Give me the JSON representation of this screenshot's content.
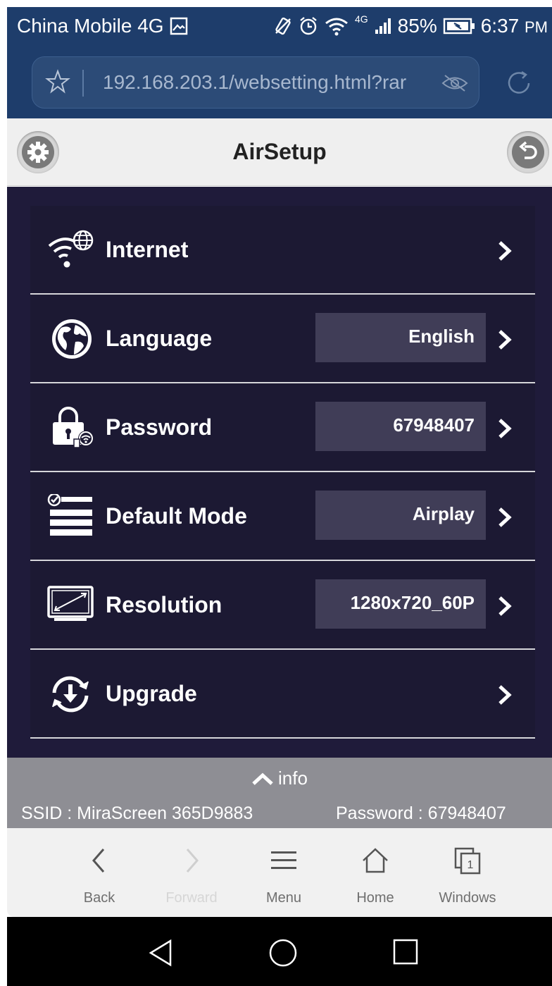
{
  "status_bar": {
    "carrier": "China Mobile 4G",
    "signal_label": "4G",
    "battery": "85%",
    "time": "6:37",
    "ampm": "PM"
  },
  "browser": {
    "url": "192.168.203.1/websetting.html?rar"
  },
  "app": {
    "title": "AirSetup"
  },
  "menu": {
    "internet": {
      "label": "Internet"
    },
    "language": {
      "label": "Language",
      "value": "English"
    },
    "password": {
      "label": "Password",
      "value": "67948407"
    },
    "default_mode": {
      "label": "Default Mode",
      "value": "Airplay"
    },
    "resolution": {
      "label": "Resolution",
      "value": "1280x720_60P"
    },
    "upgrade": {
      "label": "Upgrade"
    }
  },
  "info": {
    "toggle_label": "info",
    "ssid": "SSID : MiraScreen 365D9883",
    "password": "Password : 67948407"
  },
  "toolbar": {
    "back": "Back",
    "forward": "Forward",
    "menu": "Menu",
    "home": "Home",
    "windows": "Windows",
    "windows_count": "1"
  },
  "colors": {
    "status_bar_bg": "#1e3d6b",
    "menu_bg": "#1f1b3a",
    "value_box_bg": "#403d57",
    "info_bar_bg": "#8e8e94"
  }
}
